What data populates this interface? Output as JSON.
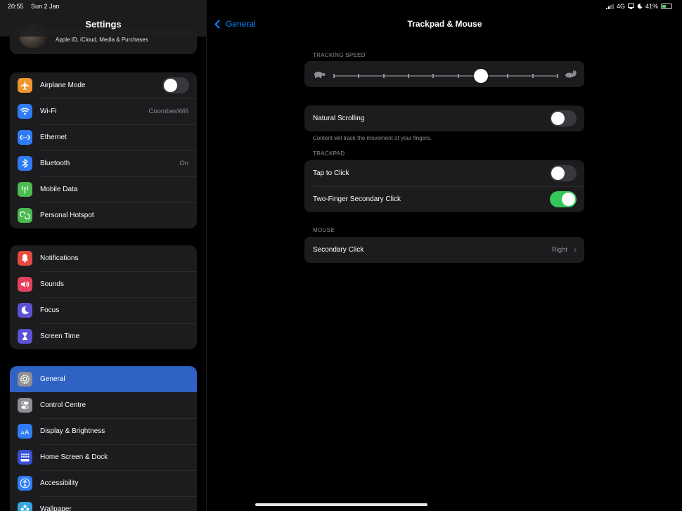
{
  "status": {
    "time": "20:55",
    "date": "Sun 2 Jan",
    "network": "4G",
    "battery": "41%",
    "battery_level": 0.41
  },
  "sidebar": {
    "title": "Settings",
    "profile_subtitle": "Apple ID, iCloud, Media & Purchases",
    "group1": [
      {
        "label": "Airplane Mode",
        "icon": "airplane-icon",
        "color": "#f0942e",
        "toggle": false
      },
      {
        "label": "Wi-Fi",
        "icon": "wifi-icon",
        "color": "#2f7cf6",
        "value": "CoombesWifi"
      },
      {
        "label": "Ethernet",
        "icon": "ethernet-icon",
        "color": "#2f7cf6"
      },
      {
        "label": "Bluetooth",
        "icon": "bluetooth-icon",
        "color": "#2f7cf6",
        "value": "On"
      },
      {
        "label": "Mobile Data",
        "icon": "antenna-icon",
        "color": "#4cba50"
      },
      {
        "label": "Personal Hotspot",
        "icon": "hotspot-icon",
        "color": "#4cba50"
      }
    ],
    "group2": [
      {
        "label": "Notifications",
        "icon": "bell-icon",
        "color": "#e5493f"
      },
      {
        "label": "Sounds",
        "icon": "speaker-icon",
        "color": "#e5405d"
      },
      {
        "label": "Focus",
        "icon": "moon-icon",
        "color": "#5d52d6"
      },
      {
        "label": "Screen Time",
        "icon": "hourglass-icon",
        "color": "#5d52d6"
      }
    ],
    "group3": [
      {
        "label": "General",
        "icon": "gear-icon",
        "color": "#8e8e93",
        "selected": true
      },
      {
        "label": "Control Centre",
        "icon": "toggles-icon",
        "color": "#8e8e93"
      },
      {
        "label": "Display & Brightness",
        "icon": "text-size-icon",
        "color": "#2f7cf6"
      },
      {
        "label": "Home Screen & Dock",
        "icon": "grid-icon",
        "color": "#3a4ed6"
      },
      {
        "label": "Accessibility",
        "icon": "accessibility-icon",
        "color": "#2f7cf6"
      },
      {
        "label": "Wallpaper",
        "icon": "flower-icon",
        "color": "#35a7e0"
      }
    ]
  },
  "detail": {
    "back_label": "General",
    "title": "Trackpad & Mouse",
    "tracking_speed_header": "TRACKING SPEED",
    "tracking_speed_value": 0.66,
    "tracking_ticks": 10,
    "natural_scrolling_label": "Natural Scrolling",
    "natural_scrolling_on": false,
    "natural_scrolling_footer": "Content will track the movement of your fingers.",
    "trackpad_header": "TRACKPAD",
    "tap_to_click_label": "Tap to Click",
    "tap_to_click_on": false,
    "two_finger_label": "Two-Finger Secondary Click",
    "two_finger_on": true,
    "mouse_header": "MOUSE",
    "secondary_click_label": "Secondary Click",
    "secondary_click_value": "Right"
  }
}
